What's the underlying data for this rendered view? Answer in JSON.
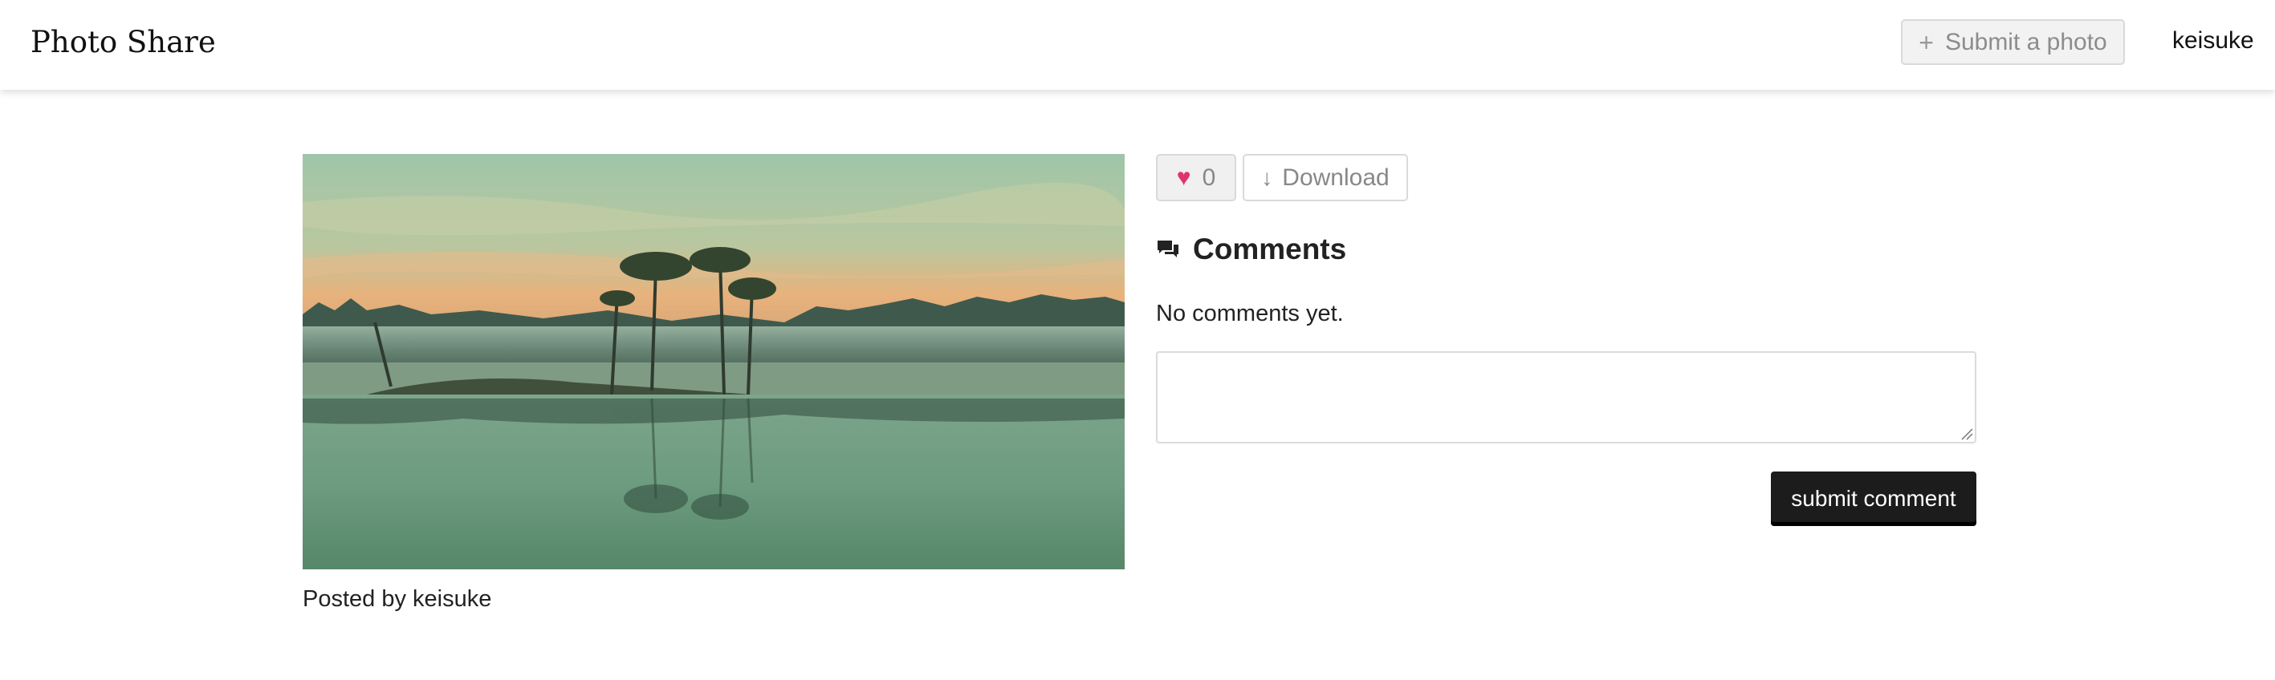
{
  "navbar": {
    "brand": "Photo Share",
    "submit_photo_label": "Submit a photo",
    "username": "keisuke"
  },
  "photo": {
    "alt": "Misty lake with bare cypress trees at sunrise",
    "posted_by": "Posted by keisuke"
  },
  "actions": {
    "like_count": "0",
    "download_label": "Download"
  },
  "comments": {
    "title": "Comments",
    "empty_text": "No comments yet.",
    "input_value": "",
    "submit_label": "submit comment"
  },
  "colors": {
    "heart": "#e0356b",
    "submit_button": "#1c1c1c"
  },
  "icons": [
    "plus-icon",
    "heart-icon",
    "arrow-down-icon",
    "comments-icon"
  ]
}
